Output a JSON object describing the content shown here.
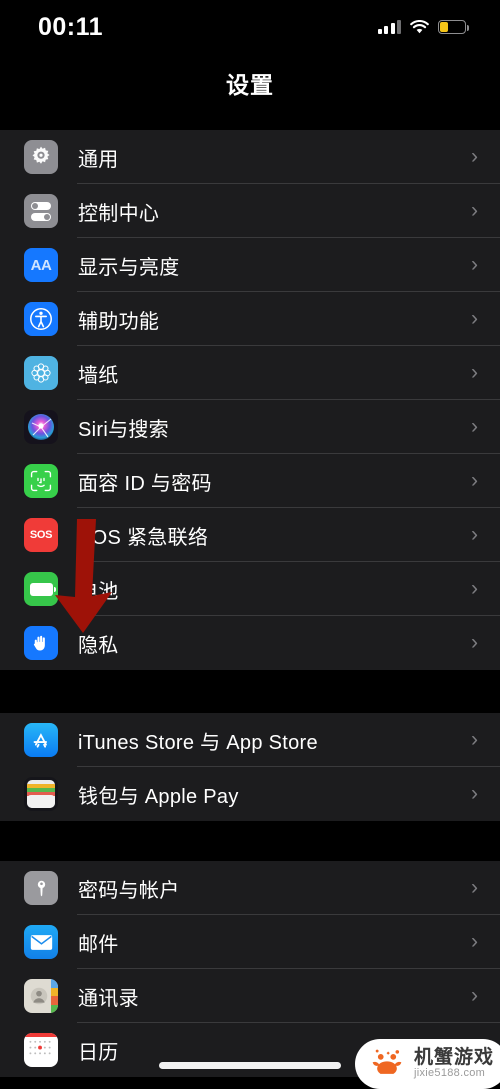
{
  "status_bar": {
    "time": "00:11",
    "signal_icon": "cellular-signal-icon",
    "wifi_icon": "wifi-icon",
    "battery_icon": "battery-low-power-icon",
    "battery_level_percent": 30,
    "battery_color": "#f5c518"
  },
  "nav": {
    "title": "设置"
  },
  "groups": [
    {
      "rows": [
        {
          "label": "通用",
          "icon": "gear-icon",
          "icon_class": "ic-general",
          "chevron": "›"
        },
        {
          "label": "控制中心",
          "icon": "control-center-icon",
          "icon_class": "ic-cc",
          "chevron": "›"
        },
        {
          "label": "显示与亮度",
          "icon": "display-aa-icon",
          "icon_class": "ic-display",
          "chevron": "›"
        },
        {
          "label": "辅助功能",
          "icon": "accessibility-icon",
          "icon_class": "ic-access",
          "chevron": "›"
        },
        {
          "label": "墙纸",
          "icon": "wallpaper-icon",
          "icon_class": "ic-wall",
          "chevron": "›"
        },
        {
          "label": "Siri与搜索",
          "icon": "siri-icon",
          "icon_class": "ic-siri",
          "chevron": "›"
        },
        {
          "label": "面容 ID 与密码",
          "icon": "face-id-icon",
          "icon_class": "ic-faceid",
          "chevron": "›"
        },
        {
          "label": "SOS 紧急联络",
          "icon": "sos-icon",
          "icon_class": "ic-sos",
          "chevron": "›"
        },
        {
          "label": "电池",
          "icon": "battery-icon",
          "icon_class": "ic-battery",
          "chevron": "›"
        },
        {
          "label": "隐私",
          "icon": "privacy-hand-icon",
          "icon_class": "ic-privacy",
          "chevron": "›"
        }
      ]
    },
    {
      "rows": [
        {
          "label": "iTunes Store 与 App Store",
          "icon": "app-store-icon",
          "icon_class": "ic-appstore",
          "chevron": "›"
        },
        {
          "label": "钱包与 Apple Pay",
          "icon": "wallet-icon",
          "icon_class": "ic-wallet",
          "chevron": "›"
        }
      ]
    },
    {
      "rows": [
        {
          "label": "密码与帐户",
          "icon": "key-icon",
          "icon_class": "ic-key",
          "chevron": "›"
        },
        {
          "label": "邮件",
          "icon": "mail-icon",
          "icon_class": "ic-mail",
          "chevron": "›"
        },
        {
          "label": "通讯录",
          "icon": "contacts-icon",
          "icon_class": "ic-contacts",
          "chevron": "›"
        },
        {
          "label": "日历",
          "icon": "calendar-icon",
          "icon_class": "ic-cal",
          "chevron": "›"
        }
      ]
    }
  ],
  "annotation": {
    "arrow_icon": "red-down-arrow-annotation",
    "arrow_color": "#9e1208",
    "points_to": "隐私"
  },
  "watermark": {
    "title": "机蟹游戏",
    "url": "jixie5188.com",
    "logo_icon": "crab-logo-icon",
    "logo_color": "#ef6722"
  },
  "home_indicator": "home-indicator"
}
